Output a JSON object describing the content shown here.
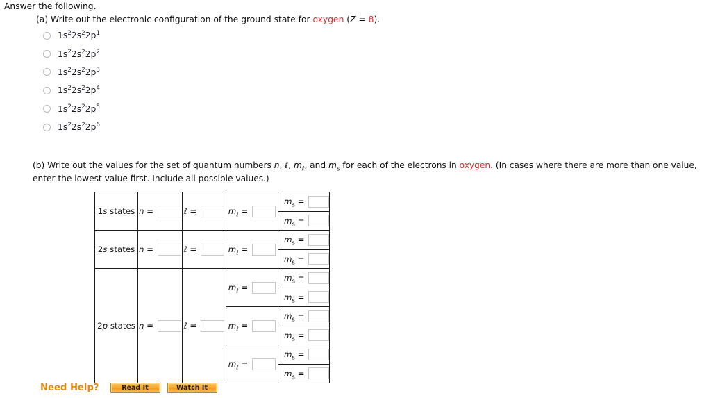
{
  "intro": "Answer the following.",
  "part_a": {
    "prompt_prefix": "(a) Write out the electronic configuration of the ground state for ",
    "highlight_element": "oxygen",
    "prompt_suffix_z": " (Z = 8).",
    "options": [
      {
        "base": "1s²2s²2p",
        "sup": "1",
        "text": "1s22s22p1",
        "selected": false
      },
      {
        "base": "1s²2s²2p",
        "sup": "2",
        "text": "1s22s22p2",
        "selected": false
      },
      {
        "base": "1s²2s²2p",
        "sup": "3",
        "text": "1s22s22p3",
        "selected": false
      },
      {
        "base": "1s²2s²2p",
        "sup": "4",
        "text": "1s22s22p4",
        "selected": false
      },
      {
        "base": "1s²2s²2p",
        "sup": "5",
        "text": "1s22s22p5",
        "selected": false
      },
      {
        "base": "1s²2s²2p",
        "sup": "6",
        "text": "1s22s22p6",
        "selected": false
      }
    ]
  },
  "part_b": {
    "text_1": "(b) Write out the values for the set of quantum numbers n, ℓ, m",
    "sub_1": "ℓ",
    "text_2": ", and m",
    "sub_2": "s",
    "text_3": " for each of the electrons in ",
    "highlight_element": "oxygen",
    "text_4": ". (In cases where there are more than one value, enter the lowest value first. Include all possible values.)"
  },
  "table": {
    "labels": {
      "n": "n =",
      "l": "ℓ =",
      "ml_prefix": "m",
      "ml_sub": "ℓ",
      "ml_eq": "=",
      "ms_prefix": "m",
      "ms_sub": "s",
      "ms_eq": "="
    },
    "rows": [
      {
        "state": "1s states",
        "state_prefix": "1",
        "state_italic": "s",
        "state_suffix": " states",
        "n_value": "",
        "l_value": "",
        "ml_groups": [
          {
            "ml_value": "",
            "ms_values": [
              "",
              ""
            ]
          }
        ]
      },
      {
        "state": "2s states",
        "state_prefix": "2",
        "state_italic": "s",
        "state_suffix": " states",
        "n_value": "",
        "l_value": "",
        "ml_groups": [
          {
            "ml_value": "",
            "ms_values": [
              "",
              ""
            ]
          }
        ]
      },
      {
        "state": "2p states",
        "state_prefix": "2",
        "state_italic": "p",
        "state_suffix": " states",
        "n_value": "",
        "l_value": "",
        "ml_groups": [
          {
            "ml_value": "",
            "ms_values": [
              "",
              ""
            ]
          },
          {
            "ml_value": "",
            "ms_values": [
              "",
              ""
            ]
          },
          {
            "ml_value": "",
            "ms_values": [
              "",
              ""
            ]
          }
        ]
      }
    ]
  },
  "need_help": {
    "label": "Need Help?",
    "buttons": [
      {
        "label": "Read It",
        "name": "read-it-button"
      },
      {
        "label": "Watch It",
        "name": "watch-it-button"
      }
    ]
  },
  "colors": {
    "highlight": "#e8252a",
    "help_label": "#e08a12",
    "button_border": "#d98000",
    "table_border": "#1c1c1c",
    "input_border": "#c9c9c9"
  }
}
